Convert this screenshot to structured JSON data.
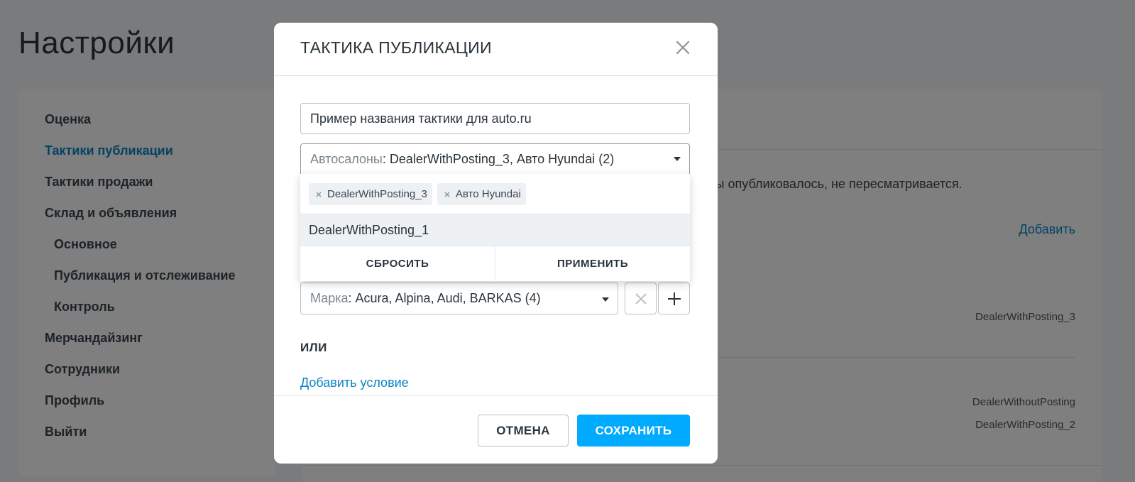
{
  "page": {
    "title": "Настройки"
  },
  "sidebar": {
    "items": [
      {
        "label": "Оценка"
      },
      {
        "label": "Тактики публикации"
      },
      {
        "label": "Тактики продажи"
      },
      {
        "label": "Склад и объявления"
      },
      {
        "label": "Основное"
      },
      {
        "label": "Публикация и отслеживание"
      },
      {
        "label": "Контроль"
      },
      {
        "label": "Мерчандайзинг"
      },
      {
        "label": "Сотрудники"
      },
      {
        "label": "Профиль"
      },
      {
        "label": "Выйти"
      }
    ],
    "active_item": "Тактики публикации"
  },
  "content": {
    "description_fragment": "жды опубликовалось, не пересматривается.",
    "add_link": "Добавить",
    "rows": [
      {
        "dealer": "DealerWithPosting_3"
      },
      {
        "dealer": "DealerWithoutPosting"
      },
      {
        "dealer": "DealerWithPosting_2"
      }
    ]
  },
  "modal": {
    "title": "ТАКТИКА ПУБЛИКАЦИИ",
    "name_input": {
      "value": "Пример названия тактики для auto.ru"
    },
    "dealers_select": {
      "label": "Автосалоны",
      "value": ": DealerWithPosting_3, Авто Hyundai (2)"
    },
    "brand_select": {
      "label": "Марка",
      "value": ": Acura, Alpina, Audi, BARKAS (4)"
    },
    "or_label": "ИЛИ",
    "add_condition": "Добавить условие",
    "cancel_label": "ОТМЕНА",
    "save_label": "СОХРАНИТЬ"
  },
  "dropdown": {
    "selected_chips": [
      {
        "label": "DealerWithPosting_3"
      },
      {
        "label": "Авто Hyundai"
      }
    ],
    "options": [
      {
        "label": "DealerWithPosting_1"
      }
    ],
    "reset_label": "СБРОСИТЬ",
    "apply_label": "ПРИМЕНИТЬ"
  },
  "colors": {
    "accent": "#00aaff",
    "link": "#0a84c4",
    "text": "#2a343c"
  }
}
